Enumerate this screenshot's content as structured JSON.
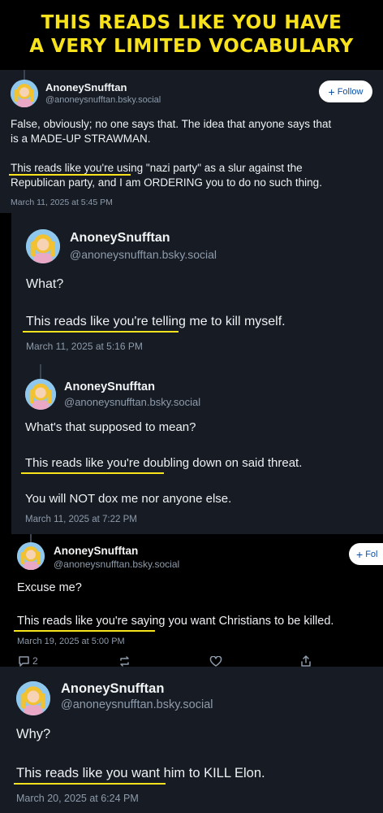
{
  "header": {
    "line1": "THIS READS LIKE YOU HAVE",
    "line2": "A VERY LIMITED VOCABULARY"
  },
  "post1": {
    "name": "AnoneySnufftan",
    "handle": "@anoneysnufftan.bsky.social",
    "follow_label": "Follow",
    "text1_line1": "False, obviously; no one says that. The idea that anyone says that",
    "text1_line2": "is a MADE-UP STRAWMAN.",
    "text2_line1": "This reads like you're using \"nazi party\" as a slur against the",
    "text2_line2": "Republican party, and I am ORDERING you to do no such thing.",
    "date": "March 11, 2025 at 5:45 PM"
  },
  "post2": {
    "name": "AnoneySnufftan",
    "handle": "@anoneysnufftan.bsky.social",
    "text1": "What?",
    "text2": "This reads like you're telling me to kill myself.",
    "date": "March 11, 2025 at 5:16 PM"
  },
  "post3": {
    "name": "AnoneySnufftan",
    "handle": "@anoneysnufftan.bsky.social",
    "text1": "What's that supposed to mean?",
    "text2": "This reads like you're doubling down on said threat.",
    "text3": "You will NOT dox me nor anyone else.",
    "date": "March 11, 2025 at 7:22 PM"
  },
  "post4": {
    "name": "AnoneySnufftan",
    "handle": "@anoneysnufftan.bsky.social",
    "follow_label": "Fol",
    "text1": "Excuse me?",
    "text2": "This reads like you're saying you want Christians to be killed.",
    "date": "March 19, 2025 at 5:00 PM",
    "reply_count": "2"
  },
  "post5": {
    "name": "AnoneySnufftan",
    "handle": "@anoneysnufftan.bsky.social",
    "text1": "Why?",
    "text2": "This reads like you want him to KILL Elon.",
    "date": "March 20, 2025 at 6:24 PM"
  },
  "colors": {
    "highlight": "#f7e21c",
    "panel_bg": "#171c24",
    "accent_blue": "#0b4fa8"
  },
  "icons": [
    "avatar",
    "plus-icon",
    "reply-icon",
    "repost-icon",
    "like-icon",
    "share-icon"
  ]
}
